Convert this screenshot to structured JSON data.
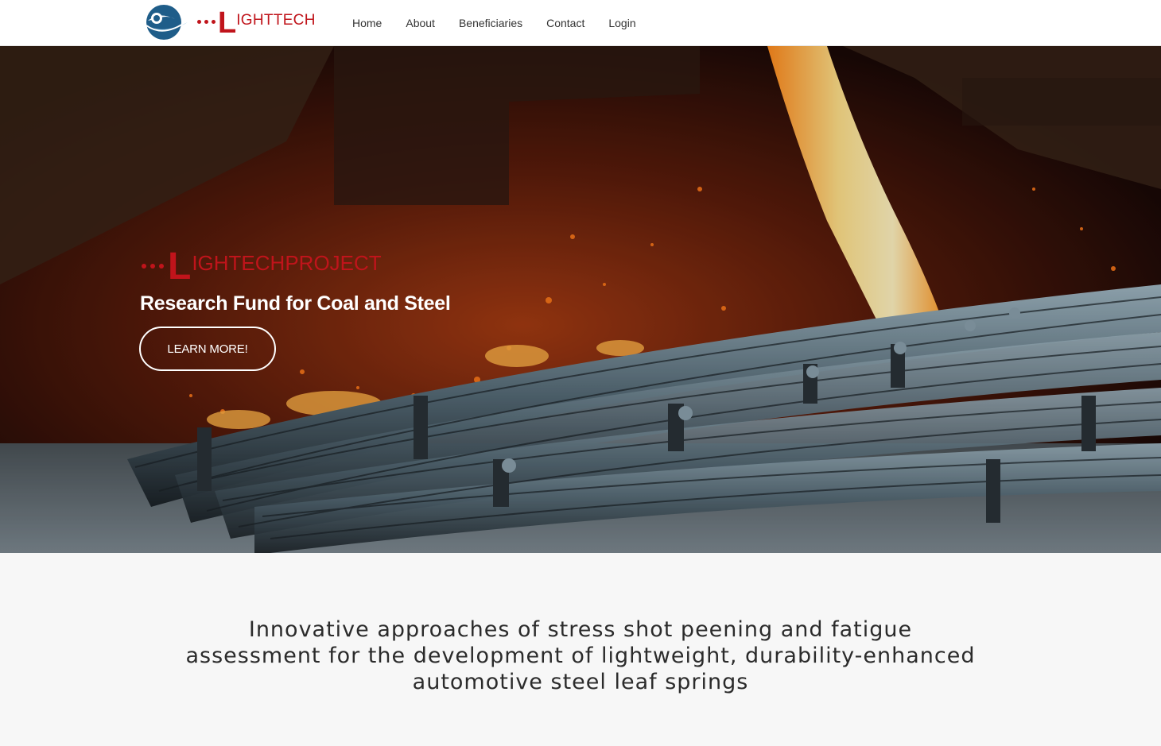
{
  "header": {
    "brand_l": "L",
    "brand_rest": "IGHTTECH",
    "nav": [
      "Home",
      "About",
      "Beneficiaries",
      "Contact",
      "Login"
    ]
  },
  "hero": {
    "brand_l": "L",
    "brand_rest": "IGHTECHPROJECT",
    "subtitle": "Research Fund for Coal and Steel",
    "button": "LEARN MORE!"
  },
  "intro": {
    "title": "Innovative approaches of stress shot peening and fatigue assessment for the development of lightweight, durability-enhanced automotive steel leaf springs"
  },
  "colors": {
    "brand_red": "#c0141b",
    "emblem_blue": "#1f5d89",
    "text_dark": "#2b2b2b"
  }
}
